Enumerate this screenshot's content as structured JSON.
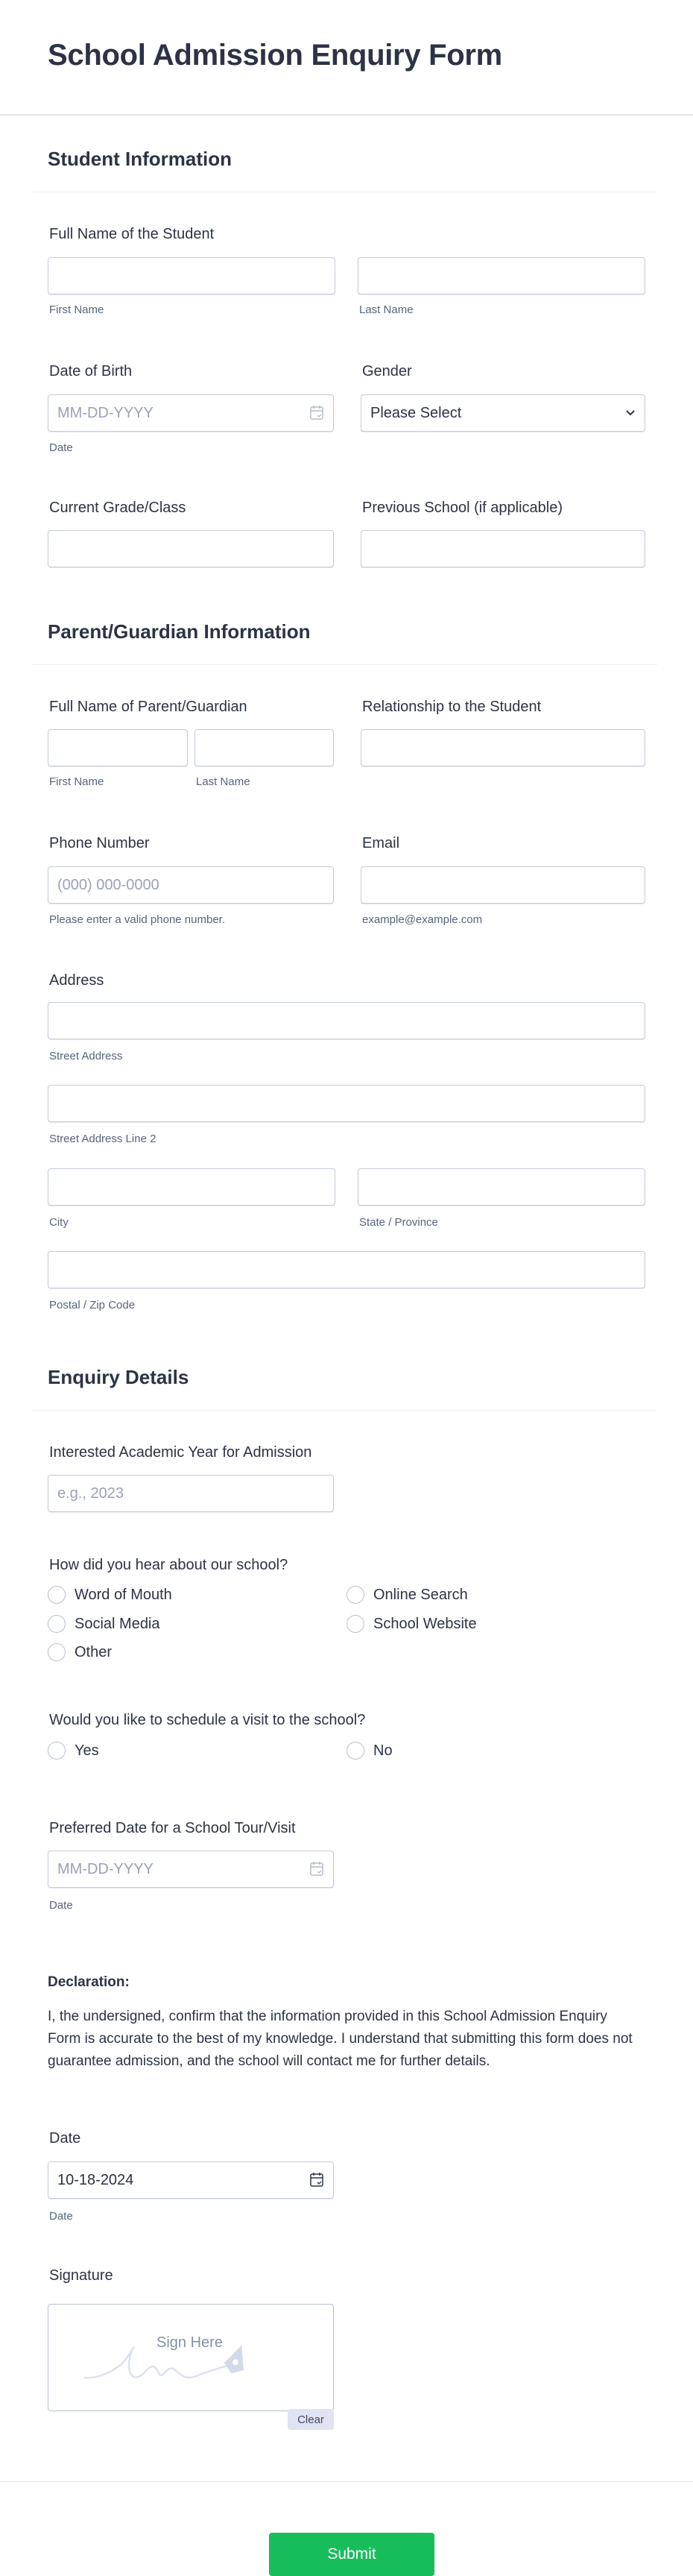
{
  "form": {
    "title": "School Admission Enquiry Form"
  },
  "sections": {
    "student": "Student Information",
    "parent": "Parent/Guardian Information",
    "enquiry": "Enquiry Details"
  },
  "student": {
    "full_name_label": "Full Name of the Student",
    "first_name_sub": "First Name",
    "last_name_sub": "Last Name",
    "first_name_value": "",
    "last_name_value": "",
    "dob_label": "Date of Birth",
    "dob_placeholder": "MM-DD-YYYY",
    "dob_sub": "Date",
    "gender_label": "Gender",
    "gender_selected": "Please Select",
    "grade_label": "Current Grade/Class",
    "grade_value": "",
    "prev_school_label": "Previous School (if applicable)",
    "prev_school_value": ""
  },
  "parent": {
    "full_name_label": "Full Name of Parent/Guardian",
    "first_name_sub": "First Name",
    "last_name_sub": "Last Name",
    "relationship_label": "Relationship to the Student",
    "phone_label": "Phone Number",
    "phone_placeholder": "(000) 000-0000",
    "phone_sub": "Please enter a valid phone number.",
    "email_label": "Email",
    "email_sub": "example@example.com",
    "address_label": "Address",
    "street_sub": "Street Address",
    "street2_sub": "Street Address Line 2",
    "city_sub": "City",
    "state_sub": "State / Province",
    "zip_sub": "Postal / Zip Code"
  },
  "enquiry": {
    "year_label": "Interested Academic Year for Admission",
    "year_placeholder": "e.g., 2023",
    "hear_label": "How did you hear about our school?",
    "hear_options": [
      "Word of Mouth",
      "Online Search",
      "Social Media",
      "School Website",
      "Other"
    ],
    "visit_label": "Would you like to schedule a visit to the school?",
    "visit_options": [
      "Yes",
      "No"
    ],
    "tour_date_label": "Preferred Date for a School Tour/Visit",
    "tour_date_placeholder": "MM-DD-YYYY",
    "tour_date_sub": "Date"
  },
  "declaration": {
    "title": "Declaration:",
    "text": "I, the undersigned, confirm that the information provided in this School Admission Enquiry Form is accurate to the best of my knowledge. I understand that submitting this form does not guarantee admission, and the school will contact me for further details."
  },
  "date_field": {
    "label": "Date",
    "value": "10-18-2024",
    "sub": "Date"
  },
  "signature": {
    "label": "Signature",
    "placeholder": "Sign Here",
    "clear_label": "Clear"
  },
  "submit": {
    "label": "Submit"
  },
  "colors": {
    "submit": "#18bd5b",
    "text": "#2c3345",
    "sublabel": "#57647e"
  }
}
